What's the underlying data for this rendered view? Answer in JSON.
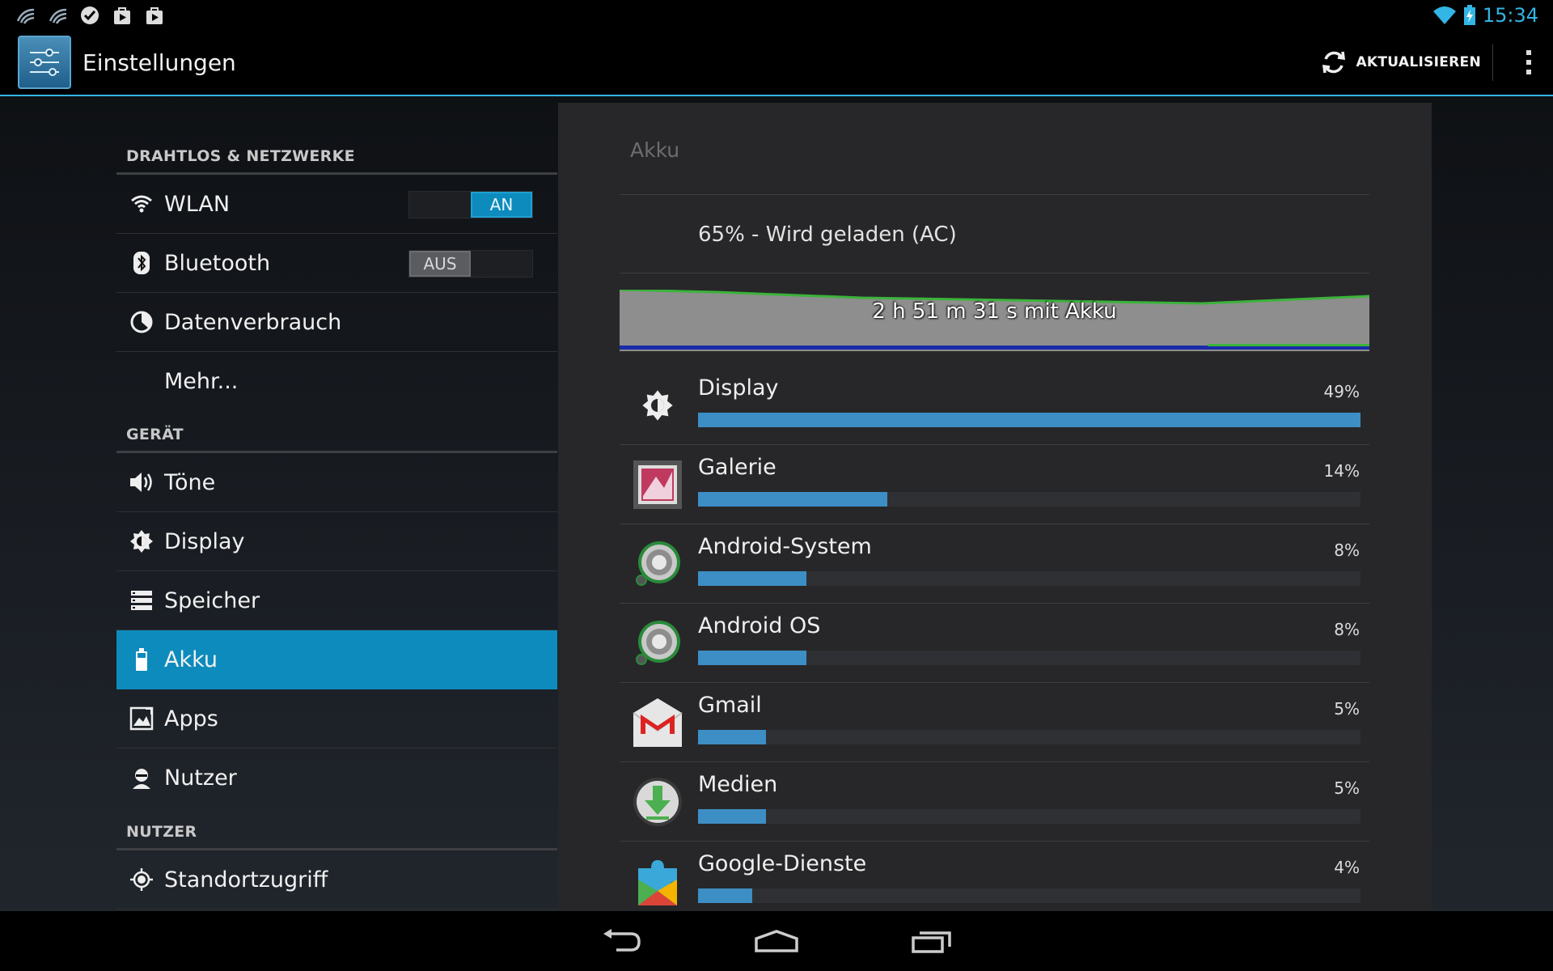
{
  "statusbar": {
    "time": "15:34",
    "notification_icons": [
      "antenna-icon",
      "antenna-icon",
      "check-circle-icon",
      "play-store-bag-icon",
      "play-store-bag-icon"
    ],
    "wifi_icon": "wifi-icon",
    "battery_icon": "battery-charging-icon"
  },
  "actionbar": {
    "title": "Einstellungen",
    "refresh_label": "AKTUALISIEREN",
    "overflow_icon": "overflow-menu-icon"
  },
  "colors": {
    "accent": "#33b5e5",
    "selected": "#0d8bbd",
    "usage_bar": "#3d8ec5",
    "graph_line": "#2e9e2e"
  },
  "sidebar": {
    "sections": [
      {
        "header": "DRAHTLOS & NETZWERKE",
        "items": [
          {
            "label": "WLAN",
            "icon": "wifi-icon",
            "toggle": "AN",
            "toggle_state": "on"
          },
          {
            "label": "Bluetooth",
            "icon": "bluetooth-icon",
            "toggle": "AUS",
            "toggle_state": "off"
          },
          {
            "label": "Datenverbrauch",
            "icon": "data-usage-icon"
          },
          {
            "label": "Mehr...",
            "icon": ""
          }
        ]
      },
      {
        "header": "GERÄT",
        "items": [
          {
            "label": "Töne",
            "icon": "speaker-icon"
          },
          {
            "label": "Display",
            "icon": "brightness-icon"
          },
          {
            "label": "Speicher",
            "icon": "storage-icon"
          },
          {
            "label": "Akku",
            "icon": "battery-icon",
            "selected": true
          },
          {
            "label": "Apps",
            "icon": "apps-icon"
          },
          {
            "label": "Nutzer",
            "icon": "user-icon"
          }
        ]
      },
      {
        "header": "NUTZER",
        "items": [
          {
            "label": "Standortzugriff",
            "icon": "location-icon"
          }
        ]
      }
    ]
  },
  "battery": {
    "title": "Akku",
    "status": "65% - Wird geladen (AC)",
    "graph_label": "2 h 51 m 31 s mit Akku",
    "usage": [
      {
        "name": "Display",
        "percent": "49%",
        "value": 49,
        "icon": "brightness-icon"
      },
      {
        "name": "Galerie",
        "percent": "14%",
        "value": 14,
        "icon": "gallery-icon"
      },
      {
        "name": "Android-System",
        "percent": "8%",
        "value": 8,
        "icon": "android-system-icon"
      },
      {
        "name": "Android OS",
        "percent": "8%",
        "value": 8,
        "icon": "android-os-icon"
      },
      {
        "name": "Gmail",
        "percent": "5%",
        "value": 5,
        "icon": "gmail-icon"
      },
      {
        "name": "Medien",
        "percent": "5%",
        "value": 5,
        "icon": "media-download-icon"
      },
      {
        "name": "Google-Dienste",
        "percent": "4%",
        "value": 4,
        "icon": "google-services-icon"
      }
    ]
  },
  "navbar": {
    "back_icon": "back-icon",
    "home_icon": "home-icon",
    "recents_icon": "recents-icon"
  }
}
